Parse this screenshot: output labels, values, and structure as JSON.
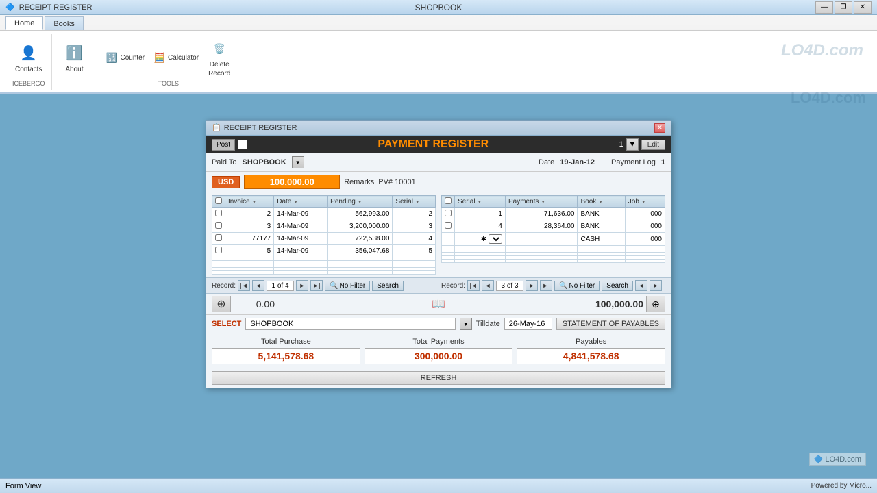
{
  "app": {
    "title": "SHOPBOOK",
    "window_title": "RECEIPT REGISTER"
  },
  "titlebar": {
    "minimize": "—",
    "restore": "❐",
    "close": "✕"
  },
  "ribbon": {
    "tabs": [
      {
        "label": "Home",
        "active": true
      },
      {
        "label": "Books",
        "active": false
      }
    ],
    "groups": {
      "contacts": {
        "label": "ICEBERGO",
        "btn_label": "Contacts"
      },
      "about": {
        "label": "",
        "btn_label": "About"
      },
      "tools": {
        "label": "TOOLS",
        "counter_label": "Counter",
        "calculator_label": "Calculator",
        "delete_label": "Delete",
        "record_label": "Record"
      }
    }
  },
  "dialog": {
    "title": "RECEIPT REGISTER",
    "payment_register_title": "PAYMENT REGISTER",
    "post_label": "Post",
    "page_num": "1",
    "edit_label": "Edit",
    "paid_to_label": "Paid To",
    "paid_to_value": "SHOPBOOK",
    "date_label": "Date",
    "date_value": "19-Jan-12",
    "payment_log_label": "Payment Log",
    "payment_log_value": "1",
    "currency": "USD",
    "amount": "100,000.00",
    "remarks_label": "Remarks",
    "remarks_value": "PV# 10001",
    "left_table": {
      "columns": [
        "",
        "Invoice",
        "Date",
        "Pending",
        "Serial"
      ],
      "rows": [
        {
          "invoice": "2",
          "date": "14-Mar-09",
          "pending": "562,993.00",
          "serial": "2"
        },
        {
          "invoice": "3",
          "date": "14-Mar-09",
          "pending": "3,200,000.00",
          "serial": "3"
        },
        {
          "invoice": "77177",
          "date": "14-Mar-09",
          "pending": "722,538.00",
          "serial": "4"
        },
        {
          "invoice": "5",
          "date": "14-Mar-09",
          "pending": "356,047.68",
          "serial": "5"
        }
      ]
    },
    "right_table": {
      "columns": [
        "",
        "Serial",
        "Payments",
        "Book",
        "Job"
      ],
      "rows": [
        {
          "serial": "1",
          "payments": "71,636.00",
          "book": "BANK",
          "job": "000"
        },
        {
          "serial": "4",
          "payments": "28,364.00",
          "book": "BANK",
          "job": "000"
        },
        {
          "serial": "*",
          "payments": "",
          "book": "CASH",
          "job": "000"
        }
      ]
    },
    "left_records": {
      "label": "Record:",
      "current": "1 of 4",
      "filter": "No Filter",
      "search": "Search"
    },
    "right_records": {
      "label": "Record:",
      "current": "3 of 3",
      "filter": "No Filter",
      "search": "Search"
    },
    "left_total": "0.00",
    "right_total": "100,000.00",
    "select_label": "SELECT",
    "select_value": "SHOPBOOK",
    "tilldate_label": "Tilldate",
    "tilldate_value": "26-May-16",
    "statement_btn": "STATEMENT OF PAYABLES",
    "summary": {
      "total_purchase_label": "Total Purchase",
      "total_purchase_value": "5,141,578.68",
      "total_payments_label": "Total Payments",
      "total_payments_value": "300,000.00",
      "payables_label": "Payables",
      "payables_value": "4,841,578.68"
    },
    "refresh_btn": "REFRESH"
  },
  "status_bar": {
    "left": "Form View",
    "right": "Powered by Micro..."
  },
  "watermark": "LO4D.com"
}
